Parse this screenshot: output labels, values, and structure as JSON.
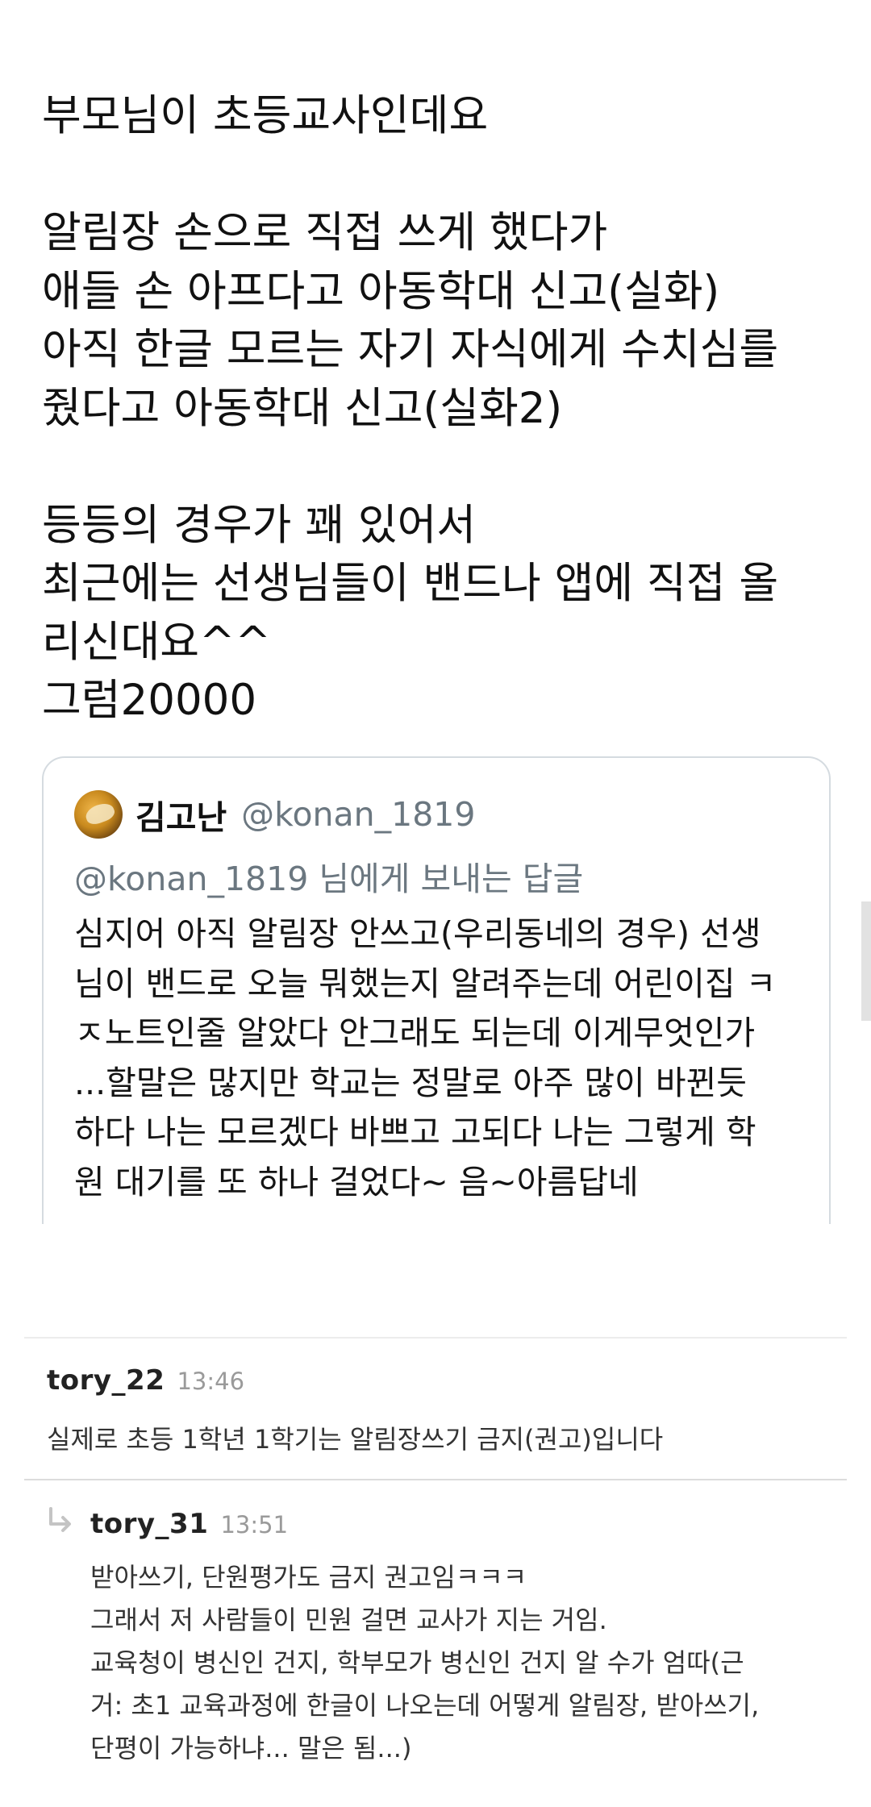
{
  "tweet": {
    "lines": [
      "부모님이 초등교사인데요",
      "",
      "알림장 손으로 직접 쓰게 했다가",
      "애들 손 아프다고 아동학대 신고(실화)",
      "아직 한글 모르는 자기 자식에게 수치심를",
      "줬다고 아동학대 신고(실화2)",
      "",
      "등등의 경우가 꽤 있어서",
      "최근에는 선생님들이 밴드나 앱에 직접 올",
      "리신대요^^",
      "그럼20000"
    ]
  },
  "quote": {
    "name": "김고난",
    "handle": "@konan_1819",
    "reply_to": "@konan_1819 님에게 보내는 답글",
    "lines": [
      "심지어 아직 알림장 안쓰고(우리동네의 경우) 선생",
      "님이 밴드로 오늘 뭐했는지 알려주는데 어린이집 ㅋ",
      "ㅈ노트인줄 알았다 안그래도 되는데 이게무엇인가",
      "...할말은 많지만 학교는 정말로 아주 많이 바뀐듯",
      "하다 나는 모르겠다 바쁘고 고되다 나는 그렇게 학",
      "원 대기를 또 하나 걸었다~ 음~아름답네"
    ]
  },
  "comments": [
    {
      "user": "tory_22",
      "time": "13:46",
      "lines": [
        "실제로 초등 1학년 1학기는 알림장쓰기 금지(권고)입니다"
      ]
    },
    {
      "user": "tory_31",
      "time": "13:51",
      "lines": [
        "받아쓰기, 단원평가도 금지 권고임ㅋㅋㅋ",
        "그래서 저 사람들이 민원 걸면 교사가 지는 거임.",
        "교육청이 병신인 건지, 학부모가 병신인 건지 알 수가 엄따(근",
        "거: 초1 교육과정에 한글이 나오는데 어떻게 알림장, 받아쓰기,",
        "단평이 가능하냐... 말은 됨...)"
      ]
    }
  ],
  "colors": {
    "quote_border": "#d5dbe0",
    "muted_text": "#6b7780",
    "timestamp": "#9a9a9a",
    "reply_arrow": "#c4c4c4"
  }
}
